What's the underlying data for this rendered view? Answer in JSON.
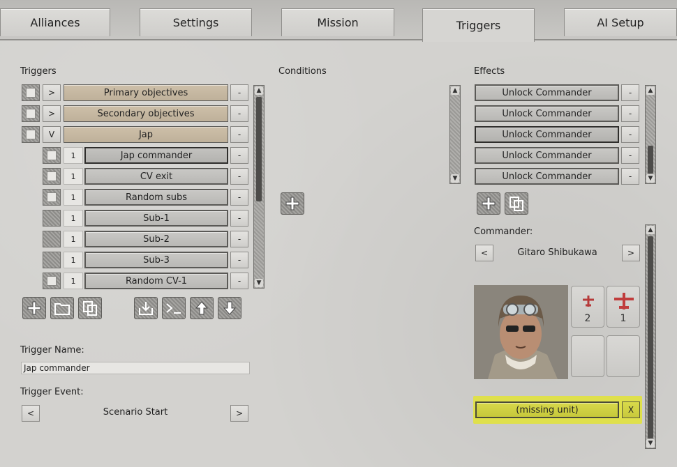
{
  "tabs": [
    {
      "label": "Alliances",
      "active": false
    },
    {
      "label": "Settings",
      "active": false
    },
    {
      "label": "Mission",
      "active": false
    },
    {
      "label": "Triggers",
      "active": true
    },
    {
      "label": "AI Setup",
      "active": false
    }
  ],
  "triggers": {
    "heading": "Triggers",
    "groups": [
      {
        "toggle": ">",
        "label": "Primary objectives",
        "remove": "-"
      },
      {
        "toggle": ">",
        "label": "Secondary objectives",
        "remove": "-"
      },
      {
        "toggle": "V",
        "label": "Jap",
        "remove": "-"
      }
    ],
    "children": [
      {
        "count": "1",
        "label": "Jap commander",
        "remove": "-"
      },
      {
        "count": "1",
        "label": "CV exit",
        "remove": "-"
      },
      {
        "count": "1",
        "label": "Random subs",
        "remove": "-"
      },
      {
        "count": "1",
        "label": "Sub-1",
        "remove": "-"
      },
      {
        "count": "1",
        "label": "Sub-2",
        "remove": "-"
      },
      {
        "count": "1",
        "label": "Sub-3",
        "remove": "-"
      },
      {
        "count": "1",
        "label": "Random CV-1",
        "remove": "-"
      }
    ],
    "toolbar": [
      "add-icon",
      "folder-icon",
      "copy-icon",
      "import-icon",
      "console-icon",
      "move-up-icon",
      "move-down-icon"
    ]
  },
  "trigger_name": {
    "label": "Trigger Name:",
    "value": "Jap commander"
  },
  "trigger_event": {
    "label": "Trigger Event:",
    "prev": "<",
    "value": "Scenario Start",
    "next": ">"
  },
  "conditions": {
    "heading": "Conditions"
  },
  "effects": {
    "heading": "Effects",
    "items": [
      {
        "label": "Unlock Commander",
        "remove": "-"
      },
      {
        "label": "Unlock Commander",
        "remove": "-"
      },
      {
        "label": "Unlock Commander",
        "remove": "-",
        "selected": true
      },
      {
        "label": "Unlock Commander",
        "remove": "-"
      },
      {
        "label": "Unlock Commander",
        "remove": "-"
      }
    ]
  },
  "commander": {
    "label": "Commander:",
    "prev": "<",
    "name": "Gitaro Shibukawa",
    "next": ">",
    "slots": [
      {
        "icon": "plane-small-icon",
        "count": "2"
      },
      {
        "icon": "plane-large-icon",
        "count": "1"
      },
      {
        "icon": "",
        "count": ""
      },
      {
        "icon": "",
        "count": ""
      }
    ]
  },
  "unit": {
    "label": "(missing unit)",
    "remove": "X",
    "highlight": "#dfe04c"
  },
  "colors": {
    "tan": "#c6b8a1",
    "panel": "#d3d2cf",
    "accent": "#dfe04c"
  }
}
